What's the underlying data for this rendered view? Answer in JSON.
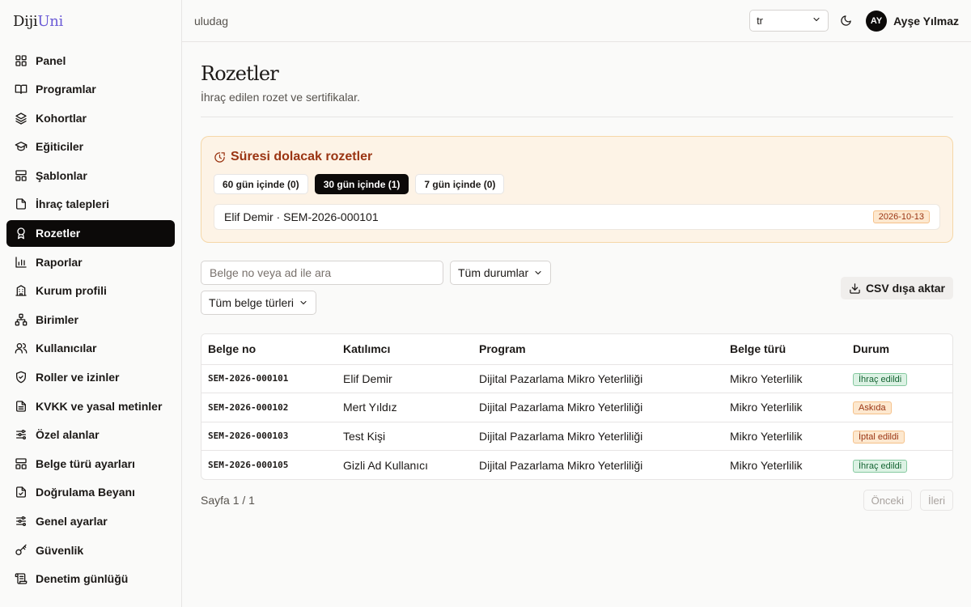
{
  "app": {
    "logo_main": "Diji",
    "logo_accent": "Uni"
  },
  "sidebar": {
    "items": [
      {
        "label": "Panel",
        "icon": "grid-icon"
      },
      {
        "label": "Programlar",
        "icon": "book-icon"
      },
      {
        "label": "Kohortlar",
        "icon": "layers-icon"
      },
      {
        "label": "Eğiticiler",
        "icon": "graduation-cap-icon"
      },
      {
        "label": "Şablonlar",
        "icon": "template-icon"
      },
      {
        "label": "İhraç talepleri",
        "icon": "file-icon"
      },
      {
        "label": "Rozetler",
        "icon": "award-icon"
      },
      {
        "label": "Raporlar",
        "icon": "bar-chart-icon"
      },
      {
        "label": "Kurum profili",
        "icon": "building-icon"
      },
      {
        "label": "Birimler",
        "icon": "network-icon"
      },
      {
        "label": "Kullanıcılar",
        "icon": "users-icon"
      },
      {
        "label": "Roller ve izinler",
        "icon": "shield-check-icon"
      },
      {
        "label": "KVKK ve yasal metinler",
        "icon": "file-text-icon"
      },
      {
        "label": "Özel alanlar",
        "icon": "sliders-icon"
      },
      {
        "label": "Belge türü ayarları",
        "icon": "template-icon"
      },
      {
        "label": "Doğrulama Beyanı",
        "icon": "file-check-icon"
      },
      {
        "label": "Genel ayarlar",
        "icon": "sliders-icon"
      },
      {
        "label": "Güvenlik",
        "icon": "key-icon"
      },
      {
        "label": "Denetim günlüğü",
        "icon": "scroll-icon"
      }
    ],
    "active_index": 6
  },
  "topbar": {
    "org": "uludag",
    "language": "tr",
    "avatar_initials": "AY",
    "user_name": "Ayşe Yılmaz"
  },
  "page": {
    "title": "Rozetler",
    "subtitle": "İhraç edilen rozet ve sertifikalar."
  },
  "expiring": {
    "title": "Süresi dolacak rozetler",
    "chips": [
      "60 gün içinde (0)",
      "30 gün içinde (1)",
      "7 gün içinde (0)"
    ],
    "active_chip": 1,
    "row_text": "Elif Demir · SEM-2026-000101",
    "row_date": "2026-10-13"
  },
  "filters": {
    "search_placeholder": "Belge no veya ad ile ara",
    "status_filter": "Tüm durumlar",
    "type_filter": "Tüm belge türleri",
    "csv_label": "CSV dışa aktar"
  },
  "table": {
    "headers": [
      "Belge no",
      "Katılımcı",
      "Program",
      "Belge türü",
      "Durum"
    ],
    "rows": [
      {
        "no": "SEM-2026-000101",
        "participant": "Elif Demir",
        "program": "Dijital Pazarlama Mikro Yeterliliği",
        "type": "Mikro Yeterlilik",
        "status": "İhraç edildi",
        "status_color": "#166534"
      },
      {
        "no": "SEM-2026-000102",
        "participant": "Mert Yıldız",
        "program": "Dijital Pazarlama Mikro Yeterliliği",
        "type": "Mikro Yeterlilik",
        "status": "Askıda",
        "status_color": "#9a3412"
      },
      {
        "no": "SEM-2026-000103",
        "participant": "Test Kişi",
        "program": "Dijital Pazarlama Mikro Yeterliliği",
        "type": "Mikro Yeterlilik",
        "status": "İptal edildi",
        "status_color": "#9a3412"
      },
      {
        "no": "SEM-2026-000105",
        "participant": "Gizli Ad Kullanıcı",
        "program": "Dijital Pazarlama Mikro Yeterliliği",
        "type": "Mikro Yeterlilik",
        "status": "İhraç edildi",
        "status_color": "#166534"
      }
    ]
  },
  "pagination": {
    "text": "Sayfa 1 / 1",
    "prev": "Önceki",
    "next": "İleri"
  },
  "colors": {
    "accent": "#6b5bd6",
    "active_nav": "#0c0a09",
    "warning_bg": "#fdf3e6",
    "warning_text": "#9a3412",
    "success_text": "#166534"
  }
}
